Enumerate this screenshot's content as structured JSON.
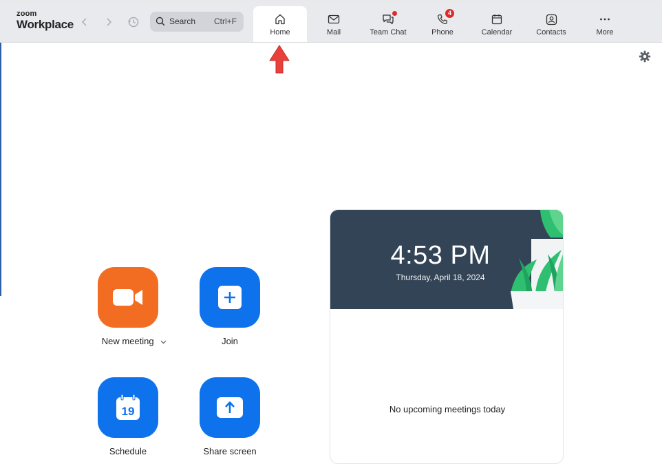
{
  "app": {
    "brand_small": "zoom",
    "brand_name": "Workplace"
  },
  "header": {
    "search": {
      "label": "Search",
      "shortcut": "Ctrl+F"
    },
    "tabs": [
      {
        "label": "Home",
        "icon": "home-icon",
        "active": true
      },
      {
        "label": "Mail",
        "icon": "mail-icon"
      },
      {
        "label": "Team Chat",
        "icon": "chat-icon",
        "has_dot": true
      },
      {
        "label": "Phone",
        "icon": "phone-icon",
        "badge": "4"
      },
      {
        "label": "Calendar",
        "icon": "calendar-icon"
      },
      {
        "label": "Contacts",
        "icon": "contacts-icon"
      },
      {
        "label": "More",
        "icon": "more-icon"
      }
    ]
  },
  "actions": [
    {
      "label": "New meeting",
      "icon": "video-camera-icon",
      "color": "#f26d21",
      "has_dropdown": true
    },
    {
      "label": "Join",
      "icon": "plus-icon",
      "color": "#0e72ed"
    },
    {
      "label": "Schedule",
      "icon": "calendar-icon",
      "icon_text": "19",
      "color": "#0e72ed"
    },
    {
      "label": "Share screen",
      "icon": "share-arrow-icon",
      "color": "#0e72ed"
    }
  ],
  "meetings_card": {
    "time": "4:53 PM",
    "date": "Thursday, April 18, 2024",
    "empty_text": "No upcoming meetings today"
  },
  "colors": {
    "accent_blue": "#0e72ed",
    "accent_orange": "#f26d21",
    "banner_bg": "#334456",
    "alert_red": "#e02929"
  }
}
